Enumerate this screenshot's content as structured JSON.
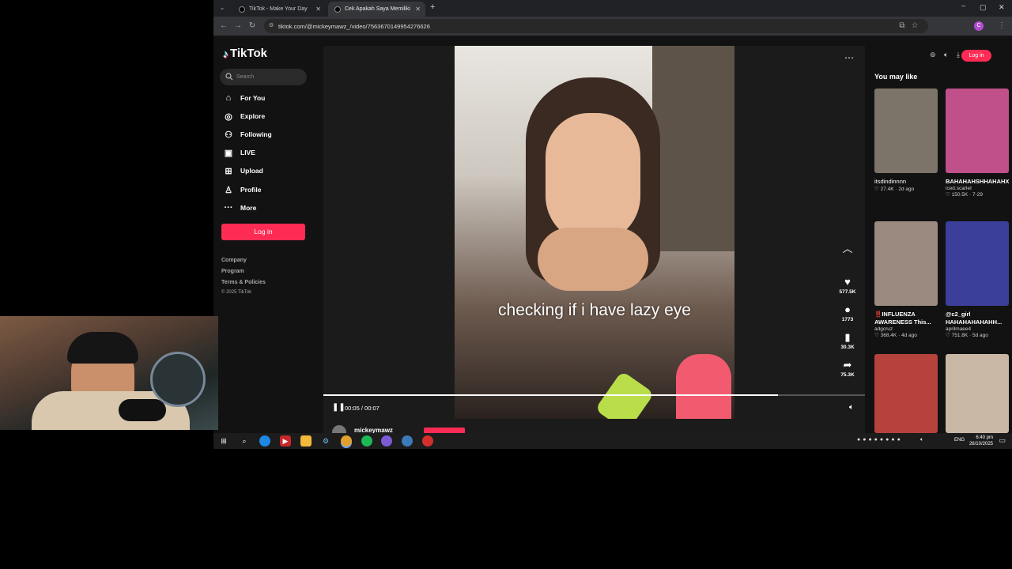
{
  "browser": {
    "tabs": [
      {
        "title": "TikTok - Make Your Day",
        "active": false
      },
      {
        "title": "Cek Apakah Saya Memiliki",
        "active": true
      }
    ],
    "url": "tiktok.com/@mickeymawz_/video/7563670149954276626"
  },
  "tiktok": {
    "brand": "TikTok",
    "search_placeholder": "Search",
    "nav": [
      {
        "label": "For You",
        "icon": "home-icon"
      },
      {
        "label": "Explore",
        "icon": "compass-icon"
      },
      {
        "label": "Following",
        "icon": "user-follow-icon"
      },
      {
        "label": "LIVE",
        "icon": "live-icon"
      },
      {
        "label": "Upload",
        "icon": "upload-icon"
      },
      {
        "label": "Profile",
        "icon": "profile-icon"
      },
      {
        "label": "More",
        "icon": "more-dots-icon"
      }
    ],
    "login_label": "Log in",
    "footer": [
      "Company",
      "Program",
      "Terms & Policies"
    ],
    "copyright": "© 2025 TikTok",
    "top_login_label": "Log in"
  },
  "video": {
    "caption": "checking if i have lazy eye",
    "time": "00:05 / 00:07",
    "progress": 0.84,
    "author": "mickeymawz"
  },
  "actions": {
    "likes": "577.5K",
    "comments": "1773",
    "saves": "30.3K",
    "shares": "75.3K"
  },
  "recommendations": {
    "heading": "You may like",
    "items": [
      {
        "title": "itsdindinnnn",
        "user": "",
        "meta": "♡ 27.4K · 2d ago",
        "color": "#7c7468"
      },
      {
        "title": "BAHAHAHSHHAHAHX",
        "user": "iced.scarlet",
        "meta": "♡ 150.5K · 7-29",
        "color": "#c0508a"
      },
      {
        "title": "‼️INFLUENZA AWARENESS This...",
        "user": "adgcruz",
        "meta": "♡ 368.4K · 4d ago",
        "color": "#9a8a80"
      },
      {
        "title": "@c2_girl HAHAHAHAHAHH...",
        "user": "aprilmaee4",
        "meta": "♡ 751.8K · 5d ago",
        "color": "#3b3f9a"
      },
      {
        "title": "",
        "user": "",
        "meta": "",
        "color": "#b6423c"
      },
      {
        "title": "",
        "user": "",
        "meta": "",
        "color": "#c9b7a6"
      }
    ]
  },
  "taskbar": {
    "lang": "ENG",
    "time": "6:40 pm",
    "date": "26/10/2025"
  },
  "colors": {
    "accent": "#fe2c55",
    "page_bg": "#121212"
  }
}
